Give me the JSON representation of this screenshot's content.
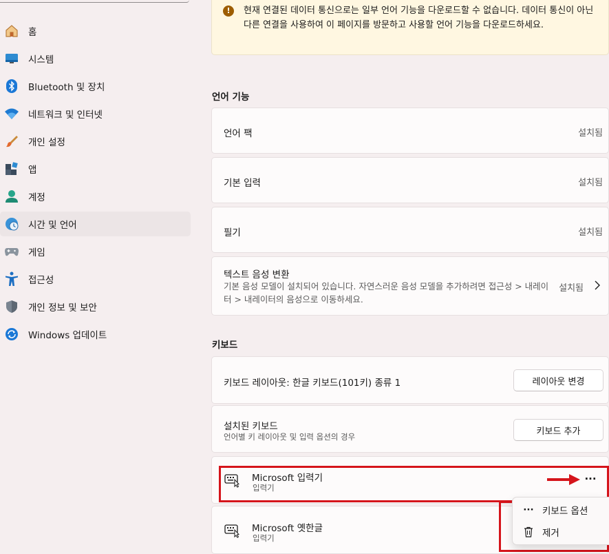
{
  "sidebar": {
    "items": [
      {
        "label": "홈",
        "icon": "home-icon"
      },
      {
        "label": "시스템",
        "icon": "system-icon"
      },
      {
        "label": "Bluetooth 및 장치",
        "icon": "bluetooth-icon"
      },
      {
        "label": "네트워크 및 인터넷",
        "icon": "wifi-icon"
      },
      {
        "label": "개인 설정",
        "icon": "brush-icon"
      },
      {
        "label": "앱",
        "icon": "apps-icon"
      },
      {
        "label": "계정",
        "icon": "account-icon"
      },
      {
        "label": "시간 및 언어",
        "icon": "time-language-icon",
        "active": true
      },
      {
        "label": "게임",
        "icon": "gamepad-icon"
      },
      {
        "label": "접근성",
        "icon": "accessibility-icon"
      },
      {
        "label": "개인 정보 및 보안",
        "icon": "shield-icon"
      },
      {
        "label": "Windows 업데이트",
        "icon": "update-icon"
      }
    ]
  },
  "banner": {
    "icon": "warning-icon",
    "text": "현재 연결된 데이터 통신으로는 일부 언어 기능을 다운로드할 수 없습니다. 데이터 통신이 아닌 다른 연결을 사용하여 이 페이지를 방문하고 사용할 언어 기능을 다운로드하세요."
  },
  "language_features": {
    "title": "언어 기능",
    "items": [
      {
        "label": "언어 팩",
        "status": "설치됨"
      },
      {
        "label": "기본 입력",
        "status": "설치됨"
      },
      {
        "label": "필기",
        "status": "설치됨"
      },
      {
        "label": "텍스트 음성 변환",
        "description": "기본 음성 모델이 설치되어 있습니다. 자연스러운 음성 모델을 추가하려면 접근성 > 내레이터 > 내레이터의 음성으로 이동하세요.",
        "status": "설치됨"
      }
    ]
  },
  "keyboard": {
    "title": "키보드",
    "layout_label": "키보드 레이아웃: 한글 키보드(101키) 종류 1",
    "layout_button": "레이아웃 변경",
    "installed_title": "설치된 키보드",
    "installed_sub": "언어별 키 레이아웃 및 입력 옵션의 경우",
    "add_button": "키보드 추가",
    "keyboards": [
      {
        "name": "Microsoft 입력기",
        "type": "입력기"
      },
      {
        "name": "Microsoft 옛한글",
        "type": "입력기"
      }
    ],
    "more_label": "···"
  },
  "context_menu": {
    "options_icon": "···",
    "options_label": "키보드 옵션",
    "remove_label": "제거"
  },
  "colors": {
    "accent_red": "#d5141b",
    "background": "#f5eeef",
    "banner_bg": "#fff7e1",
    "warning": "#9d5d00"
  }
}
